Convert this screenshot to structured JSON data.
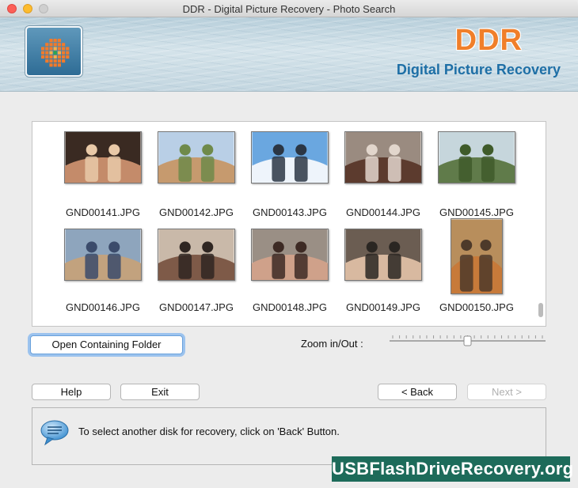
{
  "window": {
    "title": "DDR - Digital Picture Recovery - Photo Search"
  },
  "banner": {
    "brand": "DDR",
    "tagline": "Digital Picture Recovery",
    "logo_icon": "grid-mosaic-icon"
  },
  "photos": [
    {
      "name": "GND00141.JPG",
      "colors": [
        "#3a2a22",
        "#c48b6a",
        "#e9c9a8"
      ]
    },
    {
      "name": "GND00142.JPG",
      "colors": [
        "#b9cfe6",
        "#c69a6e",
        "#6f8a4a"
      ]
    },
    {
      "name": "GND00143.JPG",
      "colors": [
        "#6aa7e0",
        "#eef4fb",
        "#2b3644"
      ]
    },
    {
      "name": "GND00144.JPG",
      "colors": [
        "#9a8b80",
        "#5c3b2e",
        "#e2d6cc"
      ]
    },
    {
      "name": "GND00145.JPG",
      "colors": [
        "#c6d6dc",
        "#607b4a",
        "#3f5b2a"
      ]
    },
    {
      "name": "GND00146.JPG",
      "colors": [
        "#8ea5bd",
        "#c2a27e",
        "#3b4b6b"
      ]
    },
    {
      "name": "GND00147.JPG",
      "colors": [
        "#c9b9a9",
        "#7e5a48",
        "#2f2622"
      ]
    },
    {
      "name": "GND00148.JPG",
      "colors": [
        "#9a8f85",
        "#cfa18a",
        "#3d2a24"
      ]
    },
    {
      "name": "GND00149.JPG",
      "colors": [
        "#6b5d52",
        "#d8b9a0",
        "#2a2622"
      ]
    },
    {
      "name": "GND00150.JPG",
      "colors": [
        "#b88e5c",
        "#c77a3a",
        "#4d3a2a"
      ]
    }
  ],
  "buttons": {
    "open_folder": "Open Containing Folder",
    "help": "Help",
    "exit": "Exit",
    "back": "< Back",
    "next": "Next >"
  },
  "zoom": {
    "label": "Zoom in/Out :",
    "level": 0.5
  },
  "status": {
    "message": "To select another disk for recovery, click on 'Back' Button.",
    "icon": "speech-bubble-icon"
  },
  "watermark": "USBFlashDriveRecovery.org"
}
